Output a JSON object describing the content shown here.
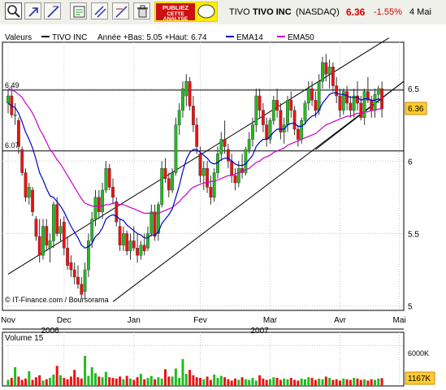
{
  "toolbar": {
    "tools": [
      "zoom-icon",
      "cursor-icon",
      "line-draw-icon",
      "annotate-icon",
      "channel-icon",
      "fibonacci-icon",
      "measure-icon",
      "trash-icon"
    ],
    "ad": {
      "line1": "PUBLIEZ",
      "line2": "CETTE",
      "line3": "ANALYSE"
    }
  },
  "header": {
    "symbol": "TIVO",
    "name": "TIVO INC",
    "exchange": "(NASDAQ)",
    "price": "6.36",
    "change": "-1.55%",
    "date": "4 Mai"
  },
  "colors": {
    "up": "#22bb22",
    "down": "#ee1111",
    "ema14": "#0000cc",
    "ema50": "#cc00cc",
    "price_badge": "#ffcc33",
    "volume_badge": "#ffcc33",
    "change_red": "#cc0000"
  },
  "price_panel": {
    "label": "Valeurs",
    "legend": [
      {
        "name": "TIVO INC",
        "color": "#000000"
      },
      {
        "name": "Année +Bas: 5.05 +Haut: 6.74",
        "color": ""
      },
      {
        "name": "EMA14",
        "color": "#0000cc"
      },
      {
        "name": "EMA50",
        "color": "#cc00cc"
      }
    ],
    "credit": "© IT-Finance.com / Boursorama",
    "ref_labels": [
      "6.49",
      "6.07"
    ],
    "current_badge": "6.36"
  },
  "volume_panel": {
    "label": "Volume 15",
    "tick": "6000K",
    "badge": "1167K"
  },
  "chart_data": {
    "type": "candlestick",
    "ylim": [
      4.97,
      6.82
    ],
    "yticks": [
      5,
      5.5,
      6,
      6.5
    ],
    "ytick_labels": [
      "5",
      "5.5",
      "6",
      "6.5"
    ],
    "hlines": [
      6.49,
      6.07
    ],
    "x_month_labels": [
      {
        "label": "Nov",
        "index": 0
      },
      {
        "label": "Dec",
        "index": 16
      },
      {
        "label": "Jan",
        "index": 36
      },
      {
        "label": "Fev",
        "index": 55
      },
      {
        "label": "Mar",
        "index": 75
      },
      {
        "label": "Avr",
        "index": 95
      },
      {
        "label": "Mai",
        "index": 112
      }
    ],
    "x_year_labels": [
      {
        "label": "2006",
        "index": 12
      },
      {
        "label": "2007",
        "index": 72
      }
    ],
    "candles": [
      [
        6.4,
        6.49,
        6.33,
        6.45
      ],
      [
        6.45,
        6.52,
        6.3,
        6.32
      ],
      [
        6.32,
        6.4,
        6.25,
        6.32
      ],
      [
        6.28,
        6.3,
        6.05,
        6.1
      ],
      [
        6.08,
        6.1,
        5.9,
        5.92
      ],
      [
        5.92,
        5.95,
        5.72,
        5.75
      ],
      [
        5.75,
        5.85,
        5.7,
        5.82
      ],
      [
        5.8,
        5.82,
        5.62,
        5.65
      ],
      [
        5.6,
        5.62,
        5.45,
        5.48
      ],
      [
        5.48,
        5.6,
        5.3,
        5.35
      ],
      [
        5.35,
        5.6,
        5.32,
        5.55
      ],
      [
        5.55,
        5.6,
        5.38,
        5.42
      ],
      [
        5.4,
        5.5,
        5.3,
        5.45
      ],
      [
        5.45,
        5.72,
        5.4,
        5.7
      ],
      [
        5.7,
        5.75,
        5.48,
        5.5
      ],
      [
        5.5,
        5.6,
        5.45,
        5.55
      ],
      [
        5.58,
        5.62,
        5.35,
        5.4
      ],
      [
        5.4,
        5.48,
        5.25,
        5.28
      ],
      [
        5.3,
        5.35,
        5.2,
        5.25
      ],
      [
        5.25,
        5.3,
        5.15,
        5.2
      ],
      [
        5.2,
        5.28,
        5.12,
        5.15
      ],
      [
        5.15,
        5.2,
        5.05,
        5.08
      ],
      [
        5.1,
        5.3,
        5.05,
        5.25
      ],
      [
        5.25,
        5.5,
        5.2,
        5.45
      ],
      [
        5.45,
        5.65,
        5.4,
        5.6
      ],
      [
        5.6,
        5.8,
        5.55,
        5.75
      ],
      [
        5.75,
        5.8,
        5.6,
        5.65
      ],
      [
        5.65,
        5.85,
        5.6,
        5.8
      ],
      [
        5.8,
        6.0,
        5.78,
        5.95
      ],
      [
        5.95,
        5.98,
        5.8,
        5.82
      ],
      [
        5.82,
        5.88,
        5.7,
        5.75
      ],
      [
        5.72,
        5.75,
        5.55,
        5.58
      ],
      [
        5.55,
        5.6,
        5.38,
        5.42
      ],
      [
        5.42,
        5.55,
        5.38,
        5.5
      ],
      [
        5.5,
        5.52,
        5.35,
        5.38
      ],
      [
        5.38,
        5.5,
        5.32,
        5.45
      ],
      [
        5.45,
        5.55,
        5.38,
        5.4
      ],
      [
        5.4,
        5.5,
        5.3,
        5.35
      ],
      [
        5.35,
        5.45,
        5.32,
        5.42
      ],
      [
        5.42,
        5.5,
        5.35,
        5.38
      ],
      [
        5.4,
        5.55,
        5.38,
        5.5
      ],
      [
        5.5,
        5.7,
        5.48,
        5.65
      ],
      [
        5.65,
        5.7,
        5.45,
        5.48
      ],
      [
        5.5,
        5.72,
        5.45,
        5.7
      ],
      [
        5.7,
        6.0,
        5.68,
        5.95
      ],
      [
        5.95,
        6.02,
        5.85,
        5.88
      ],
      [
        5.88,
        5.92,
        5.75,
        5.8
      ],
      [
        5.8,
        5.95,
        5.78,
        5.92
      ],
      [
        5.92,
        6.3,
        5.9,
        6.25
      ],
      [
        6.25,
        6.4,
        6.18,
        6.35
      ],
      [
        6.35,
        6.55,
        6.3,
        6.5
      ],
      [
        6.45,
        6.6,
        6.38,
        6.55
      ],
      [
        6.55,
        6.58,
        6.35,
        6.38
      ],
      [
        6.38,
        6.45,
        6.2,
        6.25
      ],
      [
        6.25,
        6.3,
        6.05,
        6.1
      ],
      [
        6.05,
        6.1,
        5.85,
        5.9
      ],
      [
        5.9,
        6.0,
        5.8,
        5.95
      ],
      [
        5.95,
        6.0,
        5.78,
        5.82
      ],
      [
        5.82,
        5.9,
        5.7,
        5.75
      ],
      [
        5.75,
        5.95,
        5.72,
        5.92
      ],
      [
        5.92,
        6.1,
        5.88,
        6.05
      ],
      [
        6.05,
        6.2,
        6.0,
        6.15
      ],
      [
        6.15,
        6.28,
        6.05,
        6.1
      ],
      [
        6.08,
        6.12,
        5.95,
        6.0
      ],
      [
        6.0,
        6.05,
        5.85,
        5.9
      ],
      [
        5.9,
        5.95,
        5.8,
        5.85
      ],
      [
        5.85,
        6.0,
        5.82,
        5.95
      ],
      [
        5.95,
        6.05,
        5.88,
        5.92
      ],
      [
        5.92,
        6.1,
        5.9,
        6.08
      ],
      [
        6.08,
        6.2,
        6.05,
        6.15
      ],
      [
        6.15,
        6.3,
        6.1,
        6.25
      ],
      [
        6.25,
        6.5,
        6.2,
        6.45
      ],
      [
        6.45,
        6.5,
        6.3,
        6.35
      ],
      [
        6.35,
        6.4,
        6.2,
        6.25
      ],
      [
        6.25,
        6.3,
        6.1,
        6.15
      ],
      [
        6.15,
        6.3,
        6.12,
        6.28
      ],
      [
        6.28,
        6.45,
        6.25,
        6.42
      ],
      [
        6.42,
        6.5,
        6.3,
        6.35
      ],
      [
        6.35,
        6.4,
        6.15,
        6.2
      ],
      [
        6.2,
        6.3,
        6.12,
        6.25
      ],
      [
        6.25,
        6.45,
        6.2,
        6.42
      ],
      [
        6.42,
        6.48,
        6.3,
        6.35
      ],
      [
        6.35,
        6.38,
        6.18,
        6.22
      ],
      [
        6.22,
        6.25,
        6.1,
        6.15
      ],
      [
        6.15,
        6.3,
        6.12,
        6.28
      ],
      [
        6.28,
        6.42,
        6.25,
        6.4
      ],
      [
        6.4,
        6.55,
        6.35,
        6.5
      ],
      [
        6.5,
        6.55,
        6.38,
        6.42
      ],
      [
        6.42,
        6.48,
        6.3,
        6.35
      ],
      [
        6.35,
        6.6,
        6.32,
        6.55
      ],
      [
        6.55,
        6.72,
        6.5,
        6.68
      ],
      [
        6.68,
        6.74,
        6.55,
        6.6
      ],
      [
        6.6,
        6.7,
        6.5,
        6.65
      ],
      [
        6.65,
        6.68,
        6.48,
        6.52
      ],
      [
        6.52,
        6.58,
        6.4,
        6.45
      ],
      [
        6.45,
        6.5,
        6.3,
        6.35
      ],
      [
        6.35,
        6.5,
        6.32,
        6.48
      ],
      [
        6.48,
        6.52,
        6.35,
        6.4
      ],
      [
        6.4,
        6.45,
        6.3,
        6.35
      ],
      [
        6.35,
        6.5,
        6.3,
        6.45
      ],
      [
        6.45,
        6.55,
        6.35,
        6.4
      ],
      [
        6.4,
        6.45,
        6.28,
        6.3
      ],
      [
        6.3,
        6.5,
        6.25,
        6.48
      ],
      [
        6.48,
        6.58,
        6.4,
        6.42
      ],
      [
        6.42,
        6.45,
        6.3,
        6.35
      ],
      [
        6.35,
        6.5,
        6.3,
        6.46
      ],
      [
        6.46,
        6.52,
        6.4,
        6.5
      ],
      [
        6.5,
        6.55,
        6.3,
        6.36
      ]
    ],
    "ema14": [
      6.4,
      6.38,
      6.37,
      6.33,
      6.27,
      6.2,
      6.15,
      6.09,
      6.01,
      5.92,
      5.87,
      5.81,
      5.76,
      5.75,
      5.72,
      5.69,
      5.65,
      5.6,
      5.55,
      5.51,
      5.47,
      5.42,
      5.4,
      5.41,
      5.43,
      5.48,
      5.5,
      5.54,
      5.6,
      5.62,
      5.63,
      5.62,
      5.6,
      5.59,
      5.56,
      5.54,
      5.52,
      5.5,
      5.49,
      5.47,
      5.47,
      5.49,
      5.49,
      5.51,
      5.57,
      5.6,
      5.63,
      5.67,
      5.75,
      5.83,
      5.93,
      6.01,
      6.06,
      6.08,
      6.08,
      6.06,
      6.04,
      6.02,
      5.99,
      5.98,
      5.99,
      6.01,
      6.02,
      6.02,
      6.0,
      5.98,
      5.97,
      5.97,
      5.98,
      6.01,
      6.04,
      6.1,
      6.13,
      6.15,
      6.15,
      6.17,
      6.2,
      6.22,
      6.22,
      6.22,
      6.25,
      6.26,
      6.26,
      6.24,
      6.24,
      6.26,
      6.29,
      6.31,
      6.32,
      6.35,
      6.4,
      6.43,
      6.46,
      6.47,
      6.47,
      6.46,
      6.46,
      6.45,
      6.44,
      6.44,
      6.44,
      6.42,
      6.43,
      6.43,
      6.42,
      6.42,
      6.43,
      6.42
    ],
    "ema50": [
      6.5,
      6.49,
      6.48,
      6.46,
      6.44,
      6.4,
      6.37,
      6.33,
      6.28,
      6.22,
      6.18,
      6.13,
      6.08,
      6.05,
      6.01,
      5.98,
      5.94,
      5.9,
      5.86,
      5.82,
      5.78,
      5.74,
      5.71,
      5.7,
      5.69,
      5.69,
      5.69,
      5.69,
      5.7,
      5.7,
      5.71,
      5.71,
      5.7,
      5.7,
      5.69,
      5.68,
      5.67,
      5.66,
      5.65,
      5.64,
      5.64,
      5.64,
      5.64,
      5.64,
      5.65,
      5.66,
      5.67,
      5.68,
      5.7,
      5.72,
      5.75,
      5.77,
      5.8,
      5.82,
      5.83,
      5.84,
      5.85,
      5.85,
      5.86,
      5.86,
      5.87,
      5.88,
      5.89,
      5.9,
      5.9,
      5.91,
      5.92,
      5.93,
      5.94,
      5.95,
      5.97,
      5.99,
      6.0,
      6.02,
      6.03,
      6.04,
      6.06,
      6.07,
      6.08,
      6.09,
      6.11,
      6.12,
      6.13,
      6.14,
      6.15,
      6.16,
      6.17,
      6.18,
      6.19,
      6.21,
      6.23,
      6.25,
      6.26,
      6.27,
      6.28,
      6.29,
      6.3,
      6.31,
      6.31,
      6.32,
      6.33,
      6.33,
      6.34,
      6.34,
      6.35,
      6.35,
      6.36,
      6.36
    ],
    "channel_lines": [
      {
        "x1": 0,
        "y1": 5.22,
        "x2": 109,
        "y2": 6.85
      },
      {
        "x1": 30,
        "y1": 5.03,
        "x2": 115,
        "y2": 6.55
      },
      {
        "x1": 88,
        "y1": 6.08,
        "x2": 115,
        "y2": 6.55
      }
    ],
    "volume_ylim": [
      0,
      8000
    ],
    "volume": [
      900,
      1200,
      2800,
      1400,
      900,
      1100,
      2200,
      900,
      1300,
      1600,
      800,
      1000,
      1200,
      1700,
      3000,
      1600,
      1200,
      1000,
      1400,
      2400,
      1300,
      1100,
      4500,
      1500,
      2800,
      1900,
      1400,
      1300,
      2100,
      1300,
      1200,
      1100,
      1400,
      1000,
      1500,
      1100,
      900,
      1300,
      1800,
      1000,
      1200,
      1500,
      1000,
      1300,
      1100,
      2500,
      1400,
      1400,
      2600,
      1200,
      4000,
      1800,
      2400,
      1600,
      1300,
      1200,
      1000,
      1400,
      900,
      1700,
      1200,
      1500,
      1300,
      1000,
      800,
      1100,
      900,
      1300,
      1000,
      900,
      1200,
      800,
      1600,
      1100,
      900,
      1000,
      1300,
      1200,
      900,
      1100,
      1000,
      1200,
      900,
      800,
      1100,
      1000,
      1300,
      1200,
      900,
      1100,
      1000,
      1400,
      1200,
      900,
      1000,
      800,
      1100,
      1000,
      900,
      1200,
      1100,
      900,
      1000,
      800,
      1000,
      900,
      1100,
      1167
    ]
  }
}
